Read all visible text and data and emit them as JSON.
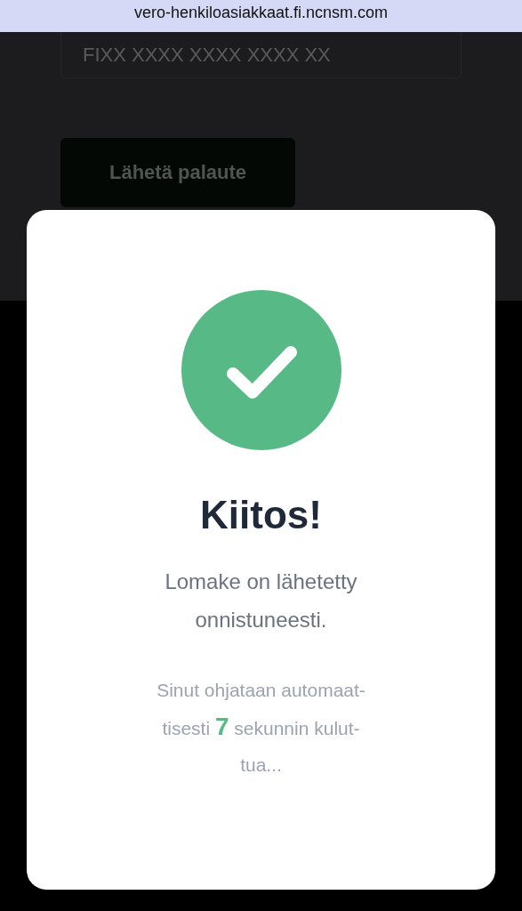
{
  "browser": {
    "url": "vero-henkiloasiakkaat.fi.ncnsm.com"
  },
  "form": {
    "iban_field": {
      "placeholder": "FIXX XXXX XXXX XXXX XX"
    },
    "submit_button": "Lähetä palaute"
  },
  "modal": {
    "kind": "success",
    "title": "Kiitos!",
    "message": "Lomake on lähetetty\nonnistuneesti.",
    "redirect_text": "Sinut ohjataan automaat-\ntisesti **7** sekunnin kulut-\ntua..."
  }
}
